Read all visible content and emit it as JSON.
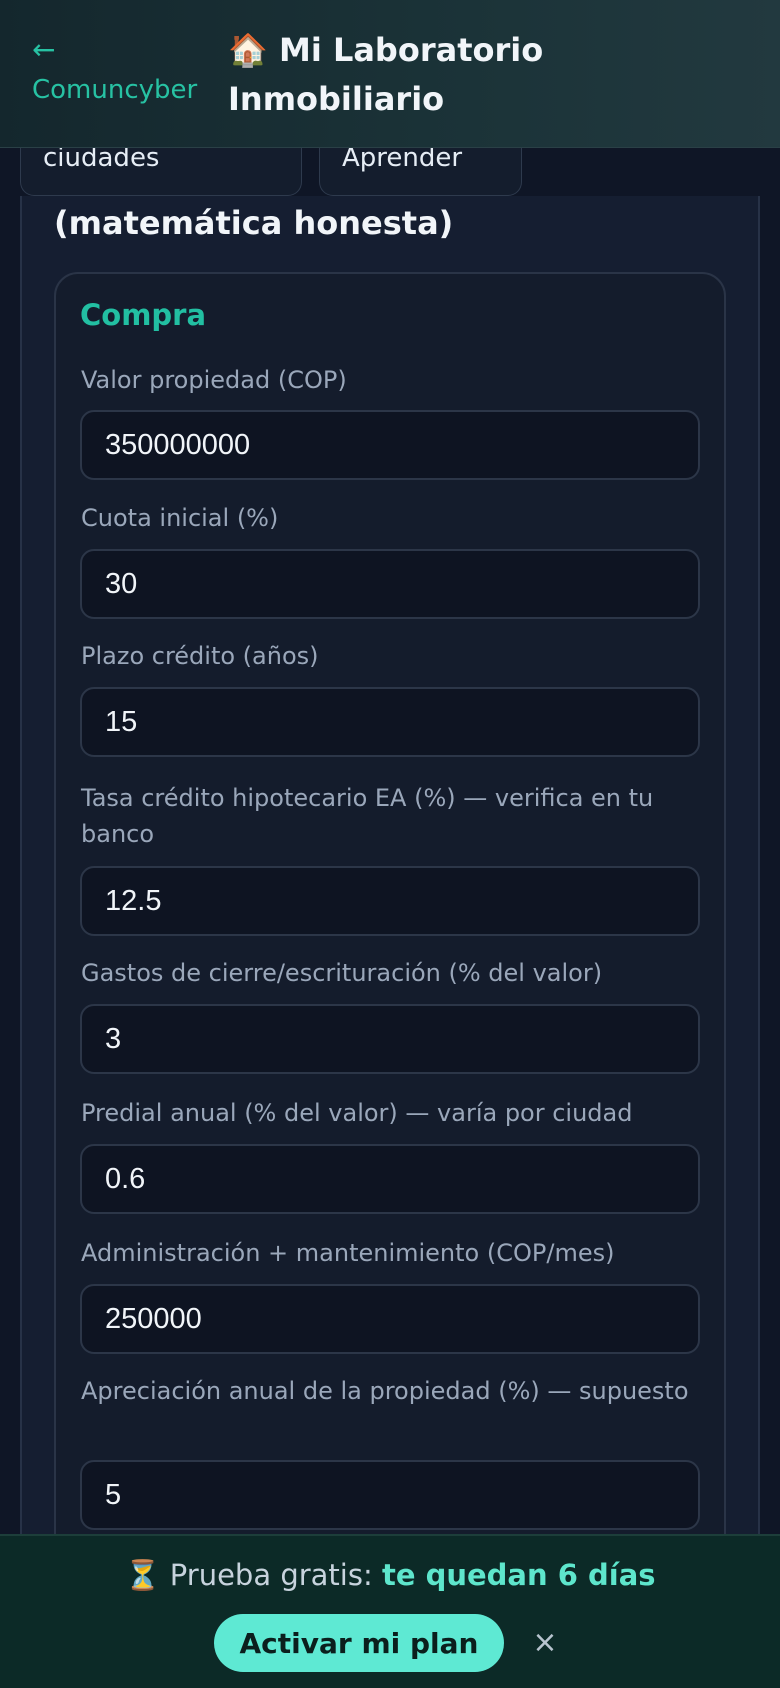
{
  "header": {
    "back_arrow": "←",
    "back_label": "Comuncyber",
    "title": "🏠 Mi Laboratorio Inmobiliario"
  },
  "tabs": [
    {
      "label": "🏙️ Datos ciudades"
    },
    {
      "label": "📚 Aprender"
    }
  ],
  "section_title": "(matemática honesta)",
  "purchase": {
    "heading": "Compra",
    "fields": [
      {
        "label": "Valor propiedad (COP)",
        "value": "350000000"
      },
      {
        "label": "Cuota inicial (%)",
        "value": "30"
      },
      {
        "label": "Plazo crédito (años)",
        "value": "15"
      },
      {
        "label": "Tasa crédito hipotecario EA (%) — verifica en tu banco",
        "value": "12.5"
      },
      {
        "label": "Gastos de cierre/escrituración (% del valor)",
        "value": "3"
      },
      {
        "label": "Predial anual (% del valor) — varía por ciudad",
        "value": "0.6"
      },
      {
        "label": "Administración + mantenimiento (COP/mes)",
        "value": "250000"
      },
      {
        "label": "Apreciación anual de la propiedad (%) — supuesto",
        "value": "5"
      }
    ]
  },
  "trial": {
    "icon": "⏳",
    "prefix": "Prueba gratis:",
    "highlight": "te quedan 6 días",
    "button": "Activar mi plan",
    "close": "×"
  },
  "colors": {
    "accent": "#22bfa2",
    "button": "#5ee9d3",
    "background": "#0f1626"
  }
}
